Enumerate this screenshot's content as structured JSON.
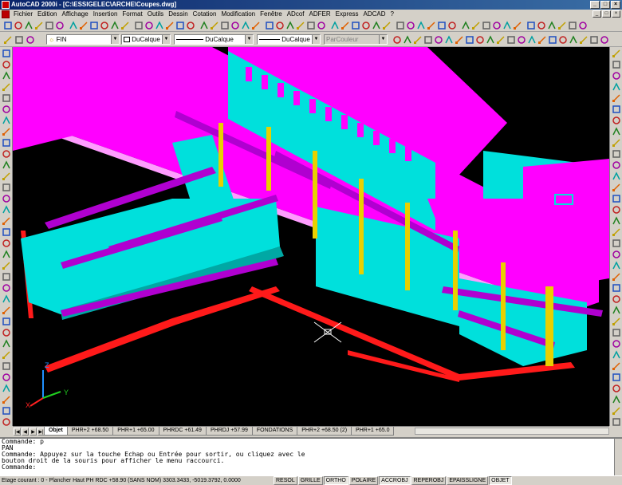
{
  "window": {
    "title": "AutoCAD 2000i - [C:\\ESSIGELEC\\ARCHE\\Coupes.dwg]",
    "controls": [
      "_",
      "□",
      "×"
    ],
    "doc_controls": [
      "_",
      "□",
      "×"
    ]
  },
  "menu": [
    "Fichier",
    "Edition",
    "Affichage",
    "Insertion",
    "Format",
    "Outils",
    "Dessin",
    "Cotation",
    "Modification",
    "Fenêtre",
    "ADcof",
    "ADFER",
    "Express",
    "ADCAD",
    "?"
  ],
  "properties": {
    "layer": "FIN",
    "color": "DuCalque",
    "linetype": "DuCalque",
    "lineweight": "DuCalque",
    "plotstyle": "ParCouleur"
  },
  "layout_tabs": [
    "Objet",
    "PHR+2 +68.50",
    "PHR+1 +65.00",
    "PHRDC +61.49",
    "PHRDJ +57.99",
    "FONDATIONS",
    "PHR+2 +68.50 (2)",
    "PHR+1 +65.0"
  ],
  "active_tab": "Objet",
  "command_lines": [
    "Commande: p",
    "PAN",
    "Commande: Appuyez sur la touche Echap ou Entrée pour sortir, ou cliquez avec le",
    "bouton droit de la souris pour afficher le menu raccourci.",
    "Commande:"
  ],
  "status": {
    "coords": "Etage courant : 0 - Plancher Haut PH RDC +58.90 (SANS NOM) 3303.3433, -5019.3792, 0.0000",
    "buttons": [
      "RESOL",
      "GRILLE",
      "ORTHO",
      "POLAIRE",
      "ACCROBJ",
      "REPEROBJ",
      "EPAISSLIGNE",
      "OBJET"
    ],
    "active": [
      "ORTHO",
      "ACCROBJ",
      "OBJET"
    ]
  },
  "ucs": {
    "x": "X",
    "y": "Y",
    "z": "Z"
  },
  "colors": {
    "slab": "#ff00ff",
    "wall": "#00e8e0",
    "column": "#e8d000",
    "beam": "#b000d0",
    "footing": "#ff0000",
    "bg": "#000000"
  }
}
